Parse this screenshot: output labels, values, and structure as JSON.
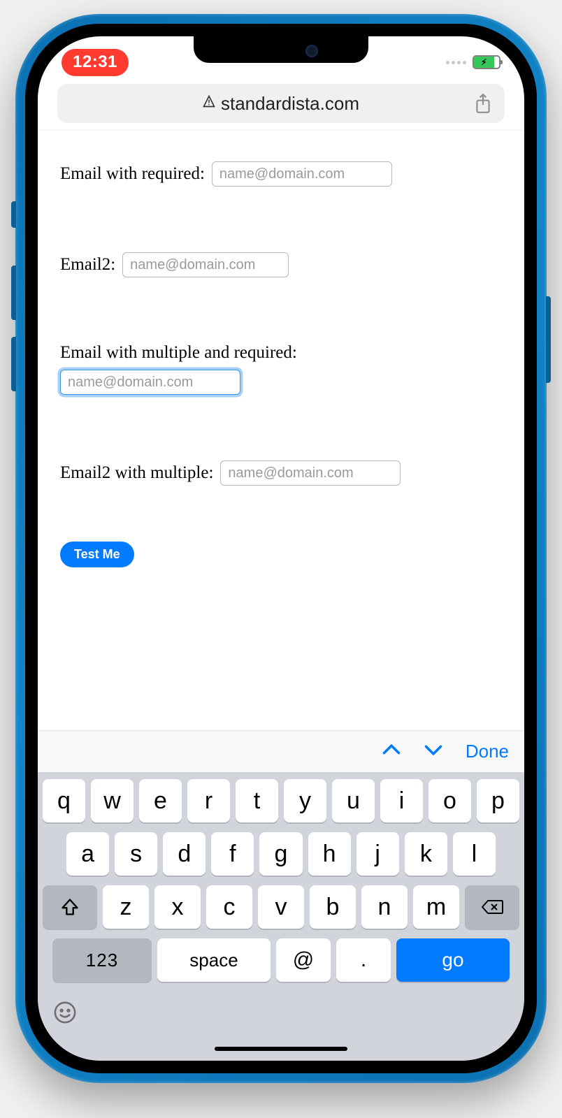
{
  "status": {
    "time": "12:31"
  },
  "addressbar": {
    "domain": "standardista.com"
  },
  "form": {
    "field1": {
      "label": "Email with required:",
      "placeholder": "name@domain.com"
    },
    "field2": {
      "label": "Email2:",
      "placeholder": "name@domain.com"
    },
    "field3": {
      "label": "Email with multiple and required:",
      "placeholder": "name@domain.com"
    },
    "field4": {
      "label": "Email2 with multiple:",
      "placeholder": "name@domain.com"
    },
    "button": "Test Me"
  },
  "kb_accessory": {
    "done": "Done"
  },
  "keyboard": {
    "row1": [
      "q",
      "w",
      "e",
      "r",
      "t",
      "y",
      "u",
      "i",
      "o",
      "p"
    ],
    "row2": [
      "a",
      "s",
      "d",
      "f",
      "g",
      "h",
      "j",
      "k",
      "l"
    ],
    "row3": [
      "z",
      "x",
      "c",
      "v",
      "b",
      "n",
      "m"
    ],
    "key123": "123",
    "space": "space",
    "at": "@",
    "dot": ".",
    "go": "go"
  }
}
